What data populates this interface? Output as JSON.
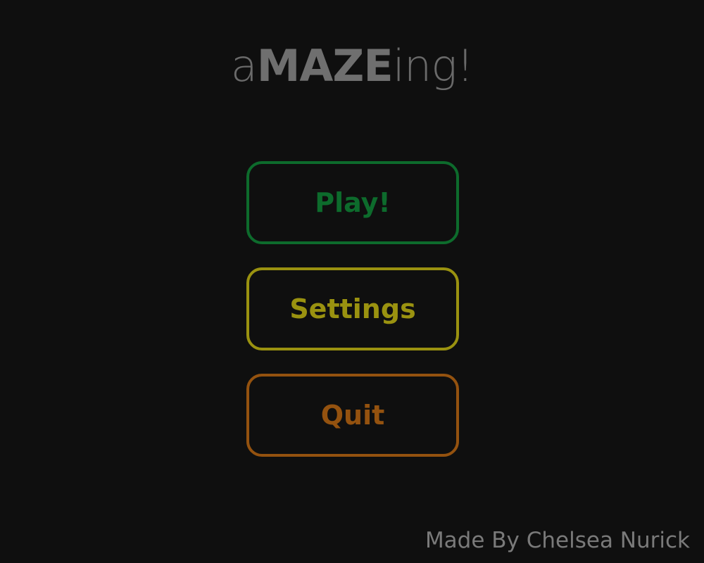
{
  "title": {
    "prefix": "a",
    "emphasis": "MAZE",
    "suffix": "ing!"
  },
  "menu": {
    "play": {
      "label": "Play!",
      "color": "#0d6b2c"
    },
    "settings": {
      "label": "Settings",
      "color": "#9a9210"
    },
    "quit": {
      "label": "Quit",
      "color": "#94520f"
    }
  },
  "footer": {
    "credit": "Made By Chelsea Nurick"
  },
  "colors": {
    "background": "#0f0f0f",
    "title": "#6a6a6a",
    "credit": "#7a7a7a"
  }
}
